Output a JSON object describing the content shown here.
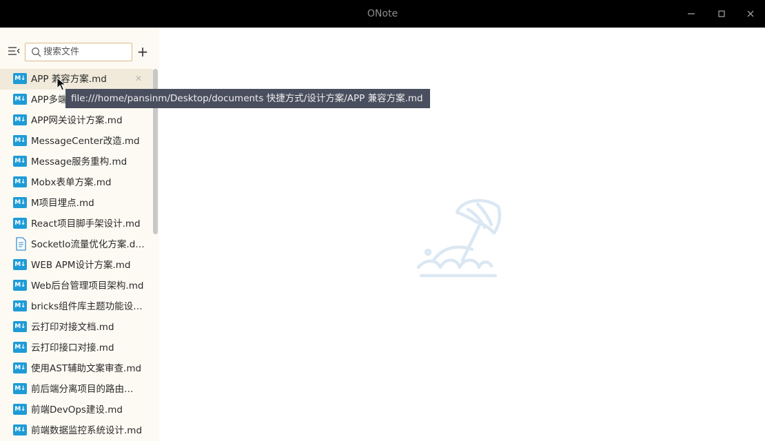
{
  "window": {
    "title": "ONote",
    "minimize_icon": "minimize-icon",
    "maximize_icon": "maximize-icon",
    "close_icon": "close-icon"
  },
  "sidebar": {
    "menu_icon": "list-collapse-icon",
    "search": {
      "placeholder": "搜索文件",
      "value": ""
    },
    "add_label": "+",
    "files": [
      {
        "name": "APP 兼容方案.md",
        "icon": "markdown-icon",
        "active": true
      },
      {
        "name": "APP多端…",
        "icon": "markdown-icon"
      },
      {
        "name": "APP网关设计方案.md",
        "icon": "markdown-icon"
      },
      {
        "name": "MessageCenter改造.md",
        "icon": "markdown-icon"
      },
      {
        "name": "Message服务重构.md",
        "icon": "markdown-icon"
      },
      {
        "name": "Mobx表单方案.md",
        "icon": "markdown-icon"
      },
      {
        "name": "M项目埋点.md",
        "icon": "markdown-icon"
      },
      {
        "name": "React项目脚手架设计.md",
        "icon": "markdown-icon"
      },
      {
        "name": "SocketIo流量优化方案.d…",
        "icon": "document-icon"
      },
      {
        "name": "WEB APM设计方案.md",
        "icon": "markdown-icon"
      },
      {
        "name": "Web后台管理项目架构.md",
        "icon": "markdown-icon"
      },
      {
        "name": "bricks组件库主题功能设…",
        "icon": "markdown-icon"
      },
      {
        "name": "云打印对接文档.md",
        "icon": "markdown-icon"
      },
      {
        "name": "云打印接口对接.md",
        "icon": "markdown-icon"
      },
      {
        "name": "使用AST辅助文案审查.md",
        "icon": "markdown-icon"
      },
      {
        "name": "前后端分离项目的路由…",
        "icon": "markdown-icon"
      },
      {
        "name": "前端DevOps建设.md",
        "icon": "markdown-icon"
      },
      {
        "name": "前端数据监控系统设计.md",
        "icon": "markdown-icon"
      }
    ]
  },
  "tooltip": {
    "text": "file:///home/pansinm/Desktop/documents 快捷方式/设计方案/APP 兼容方案.md"
  },
  "main": {
    "empty_icon": "beach-umbrella-icon"
  },
  "colors": {
    "titlebar": "#000000",
    "sidebar_bg": "#fdfaf3",
    "active_row": "#f1eadb",
    "markdown_badge": "#1e9bd7",
    "tooltip_bg": "#4a4f5f",
    "search_border": "#d9b987",
    "illustration": "#dbe8f3"
  }
}
